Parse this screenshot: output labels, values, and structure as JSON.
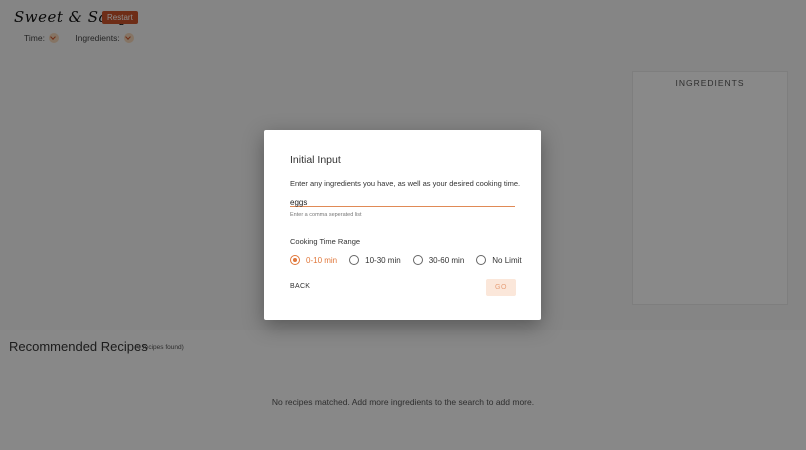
{
  "header": {
    "logo_text": "Sweet & Salty",
    "restart_label": "Restart",
    "filters": [
      {
        "label": "Time:",
        "icon": "chevron-down-icon"
      },
      {
        "label": "Ingredients:",
        "icon": "chevron-down-icon"
      }
    ]
  },
  "ingredients_panel": {
    "title": "INGREDIENTS"
  },
  "recipes": {
    "title": "Recommended Recipes",
    "count_text": "(0 recipes found)",
    "empty_message": "No recipes matched. Add more ingredients to the search to add more."
  },
  "modal": {
    "title": "Initial Input",
    "description": "Enter any ingredients you have, as well as your desired cooking time.",
    "input_value": "eggs",
    "helper_text": "Enter a comma seperated list",
    "range_label": "Cooking Time Range",
    "options": [
      {
        "label": "0-10 min"
      },
      {
        "label": "10-30 min"
      },
      {
        "label": "30-60 min"
      },
      {
        "label": "No Limit"
      }
    ],
    "selected_option": "0-10 min",
    "back_label": "BACK",
    "go_label": "GO"
  },
  "colors": {
    "accent": "#e0773a",
    "restart_bg": "#c8532a",
    "go_bg": "#fbe7da"
  }
}
